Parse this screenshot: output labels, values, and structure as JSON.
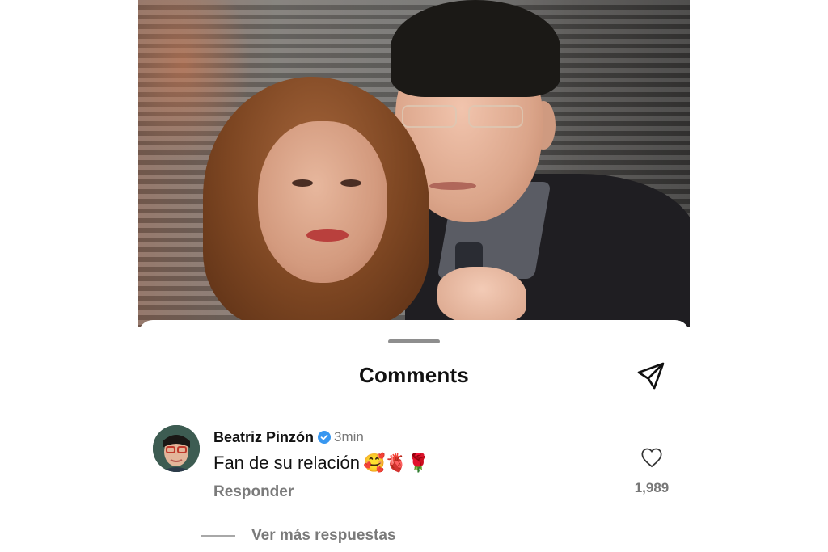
{
  "post": {
    "image_alt": "Photo of a woman and a man in glasses posing together in front of window blinds"
  },
  "comments_sheet": {
    "title": "Comments",
    "share_icon": "send-icon",
    "comment": {
      "username": "Beatriz Pinzón",
      "verified": true,
      "time": "3min",
      "text": "Fan de su relación",
      "emojis": "🥰🫀🌹",
      "reply_label": "Responder",
      "like_icon": "heart-outline-icon",
      "like_count": "1,989"
    },
    "view_more_label": "Ver más respuestas"
  },
  "colors": {
    "verified_badge": "#3897f0",
    "secondary_text": "#777777",
    "primary_text": "#111111"
  }
}
